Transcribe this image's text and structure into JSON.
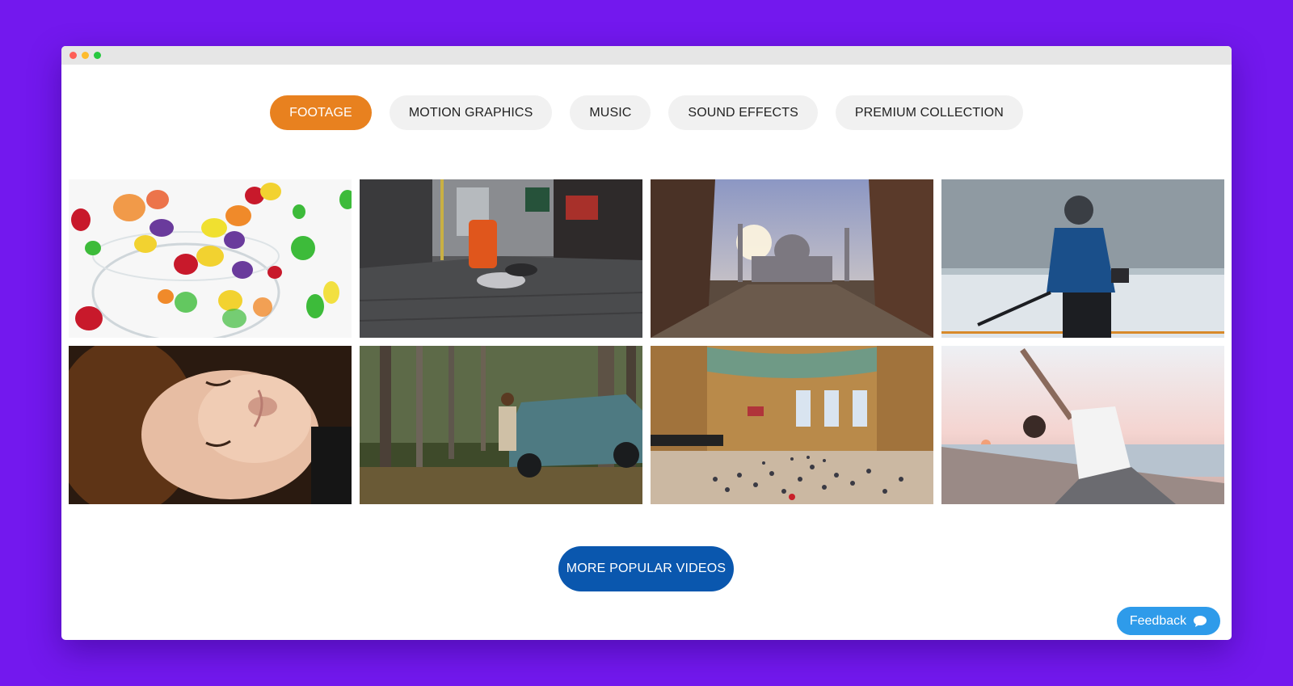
{
  "window": {
    "controls": [
      "close",
      "minimize",
      "maximize"
    ]
  },
  "tabs": [
    {
      "label": "FOOTAGE",
      "active": true
    },
    {
      "label": "MOTION GRAPHICS",
      "active": false
    },
    {
      "label": "MUSIC",
      "active": false
    },
    {
      "label": "SOUND EFFECTS",
      "active": false
    },
    {
      "label": "PREMIUM COLLECTION",
      "active": false
    }
  ],
  "videos": [
    {
      "subject": "jelly beans falling into glass bowl"
    },
    {
      "subject": "city street with trash can"
    },
    {
      "subject": "taj mahal through archway"
    },
    {
      "subject": "hockey player on ice rink"
    },
    {
      "subject": "woman smiling eyes closed"
    },
    {
      "subject": "woman by car in forest"
    },
    {
      "subject": "grand central terminal crowd"
    },
    {
      "subject": "woman doing yoga on beach at sunset"
    }
  ],
  "more_button": {
    "label": "MORE POPULAR VIDEOS"
  },
  "feedback": {
    "label": "Feedback",
    "icon": "chat-bubble-icon"
  },
  "colors": {
    "background": "#7318ee",
    "active_tab": "#e8811f",
    "more_button": "#0a57ae",
    "feedback": "#2e9bea"
  }
}
